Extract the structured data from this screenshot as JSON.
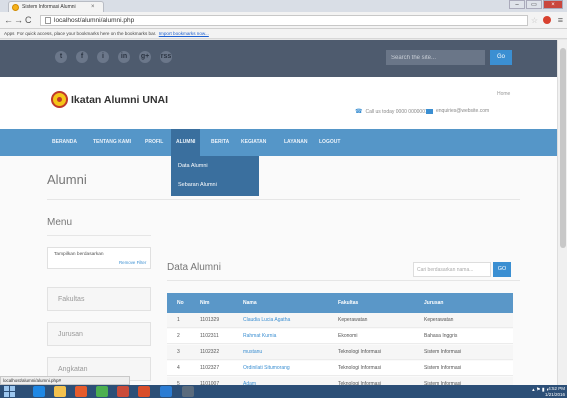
{
  "browser": {
    "tab_title": "Sistem Informasi Alumni",
    "tab_close": "×",
    "url": "localhost/alumni/alumni.php",
    "bookmark_apps": "Apps",
    "bookmark_text": "For quick access, place your bookmarks here on the bookmarks bar.",
    "bookmark_link": "Import bookmarks now...",
    "status_url": "localhost/alumni/alumni.php#",
    "win_minimize": "–",
    "win_close": "×"
  },
  "topbar": {
    "social_icons": [
      "twitter-icon",
      "facebook-icon",
      "instagram-icon",
      "linkedin-icon",
      "google-plus-icon",
      "rss-icon"
    ],
    "social_glyphs": [
      "t",
      "f",
      "i",
      "in",
      "g+",
      "rss"
    ],
    "search_placeholder": "Search the site...",
    "search_button": "Go"
  },
  "header": {
    "site_title": "Ikatan Alumni UNAI",
    "home_link": "Home",
    "phone": "Call us today 0000 0000001",
    "email": "enquiries@website.com"
  },
  "nav": {
    "items": [
      "BERANDA",
      "TENTANG KAMI",
      "PROFIL",
      "ALUMNI",
      "BERITA",
      "KEGIATAN",
      "LAYANAN",
      "LOGOUT"
    ],
    "active": "ALUMNI"
  },
  "dropdown": {
    "items": [
      "Data Alumni",
      "Sebaran Alumni"
    ]
  },
  "page": {
    "title": "Alumni"
  },
  "sidebar": {
    "heading": "Menu",
    "filter_label": "Tampilkan berdasarkan",
    "filter_remove": "Remove Filter",
    "facets": [
      "Fakultas",
      "Jurusan",
      "Angkatan"
    ]
  },
  "content": {
    "heading": "Data Alumni",
    "search_placeholder": "Cari berdasarkan nama...",
    "search_button": "GO",
    "columns": [
      "No",
      "Nim",
      "Nama",
      "Fakultas",
      "Jurusan"
    ],
    "rows": [
      [
        "1",
        "1101329",
        "Claudia Lucia Agatha",
        "Keperawatan",
        "Keperawatan"
      ],
      [
        "2",
        "1102311",
        "Rahmat Kurnia",
        "Ekonomi",
        "Bahasa Inggris"
      ],
      [
        "3",
        "1102322",
        "mustanu",
        "Teknologi Informasi",
        "Sistem Informasi"
      ],
      [
        "4",
        "1102327",
        "Ordinilati Situmorang",
        "Teknologi Informasi",
        "Sistem Informasi"
      ],
      [
        "5",
        "1101007",
        "Adam",
        "Teknologi Informasi",
        "Sistem Informasi"
      ]
    ]
  },
  "taskbar": {
    "time": "4:52 PM",
    "date": "1/21/2016"
  }
}
